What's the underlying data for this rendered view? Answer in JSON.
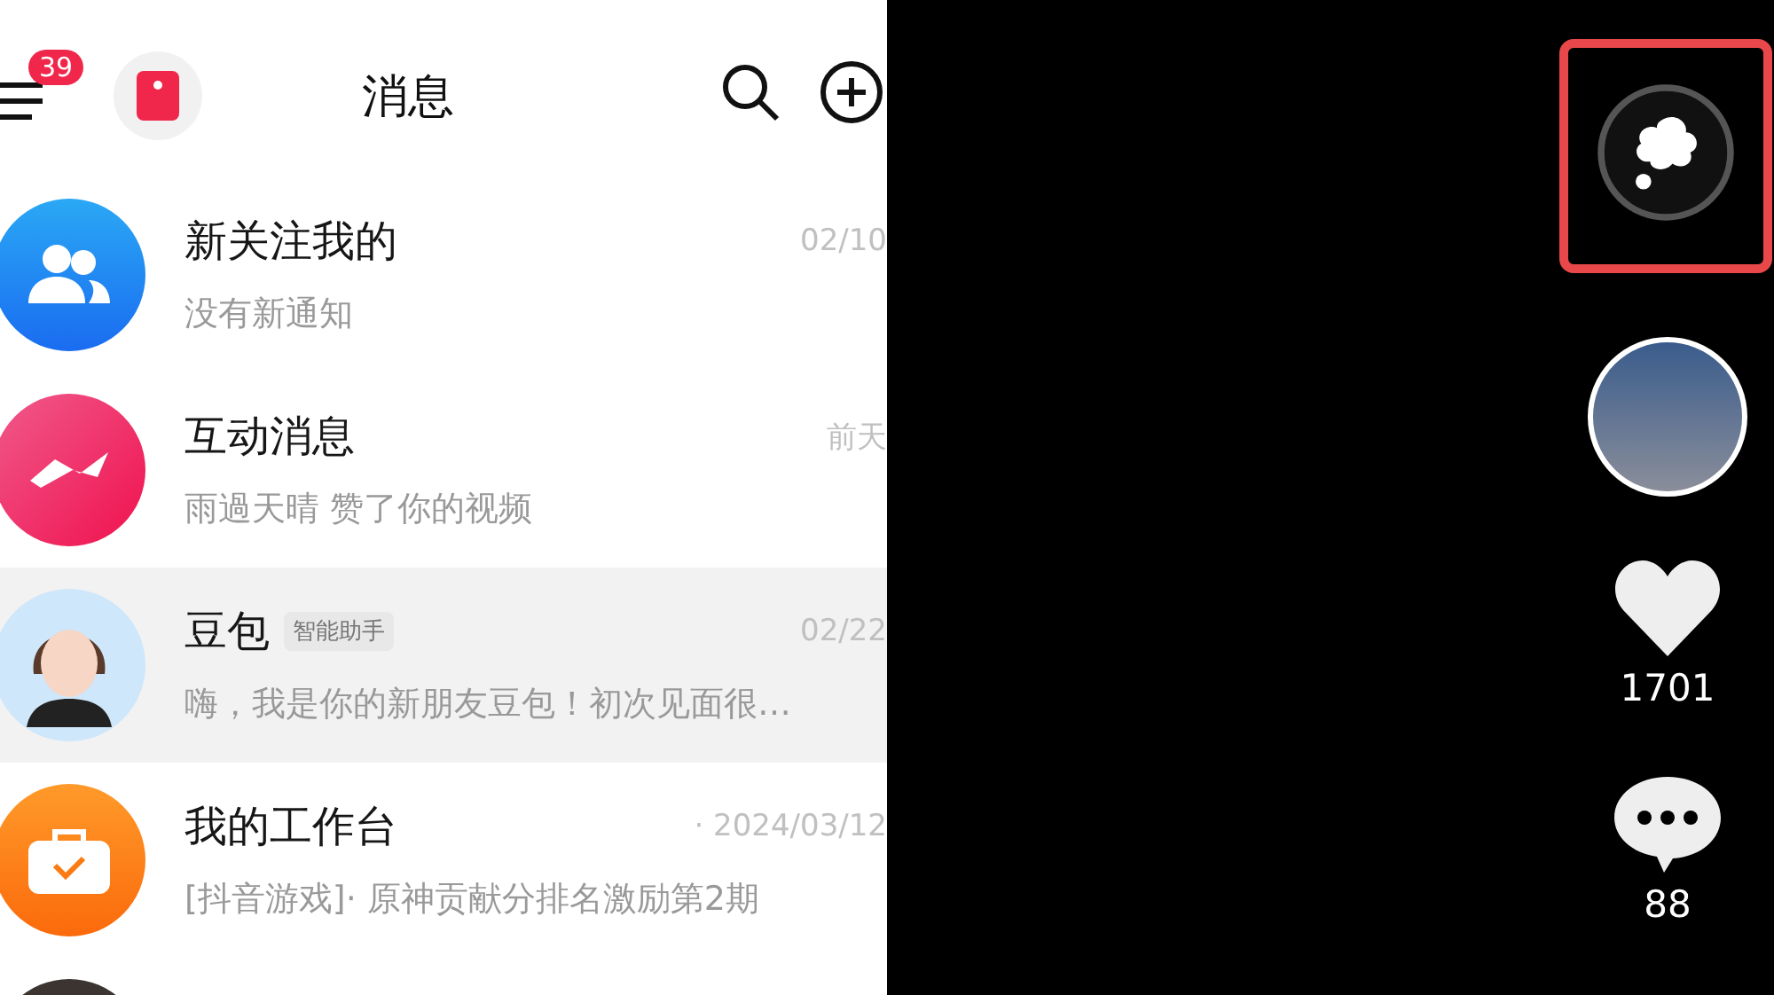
{
  "header": {
    "menu_badge": "39",
    "title": "消息"
  },
  "conversations": [
    {
      "kind": "people",
      "name": "新关注我的",
      "time": "02/10",
      "preview": "没有新通知",
      "selected": false
    },
    {
      "kind": "lightning",
      "name": "互动消息",
      "time": "前天",
      "preview": "雨過天晴 赞了你的视频",
      "selected": false
    },
    {
      "kind": "person",
      "name": "豆包",
      "tag": "智能助手",
      "time": "02/22",
      "preview": "嗨，我是你的新朋友豆包！初次见面很…",
      "selected": true
    },
    {
      "kind": "briefcase",
      "name": "我的工作台",
      "time": "· 2024/03/12",
      "preview": "[抖音游戏]· 原神贡献分排名激励第2期",
      "selected": false
    },
    {
      "kind": "dark",
      "selected": false
    }
  ],
  "video": {
    "actions": [
      {
        "kind": "bubble",
        "highlighted": true
      },
      {
        "kind": "creator",
        "highlighted": false
      },
      {
        "kind": "like",
        "count": "1701",
        "highlighted": false
      },
      {
        "kind": "comment",
        "count": "88",
        "highlighted": false
      }
    ]
  }
}
